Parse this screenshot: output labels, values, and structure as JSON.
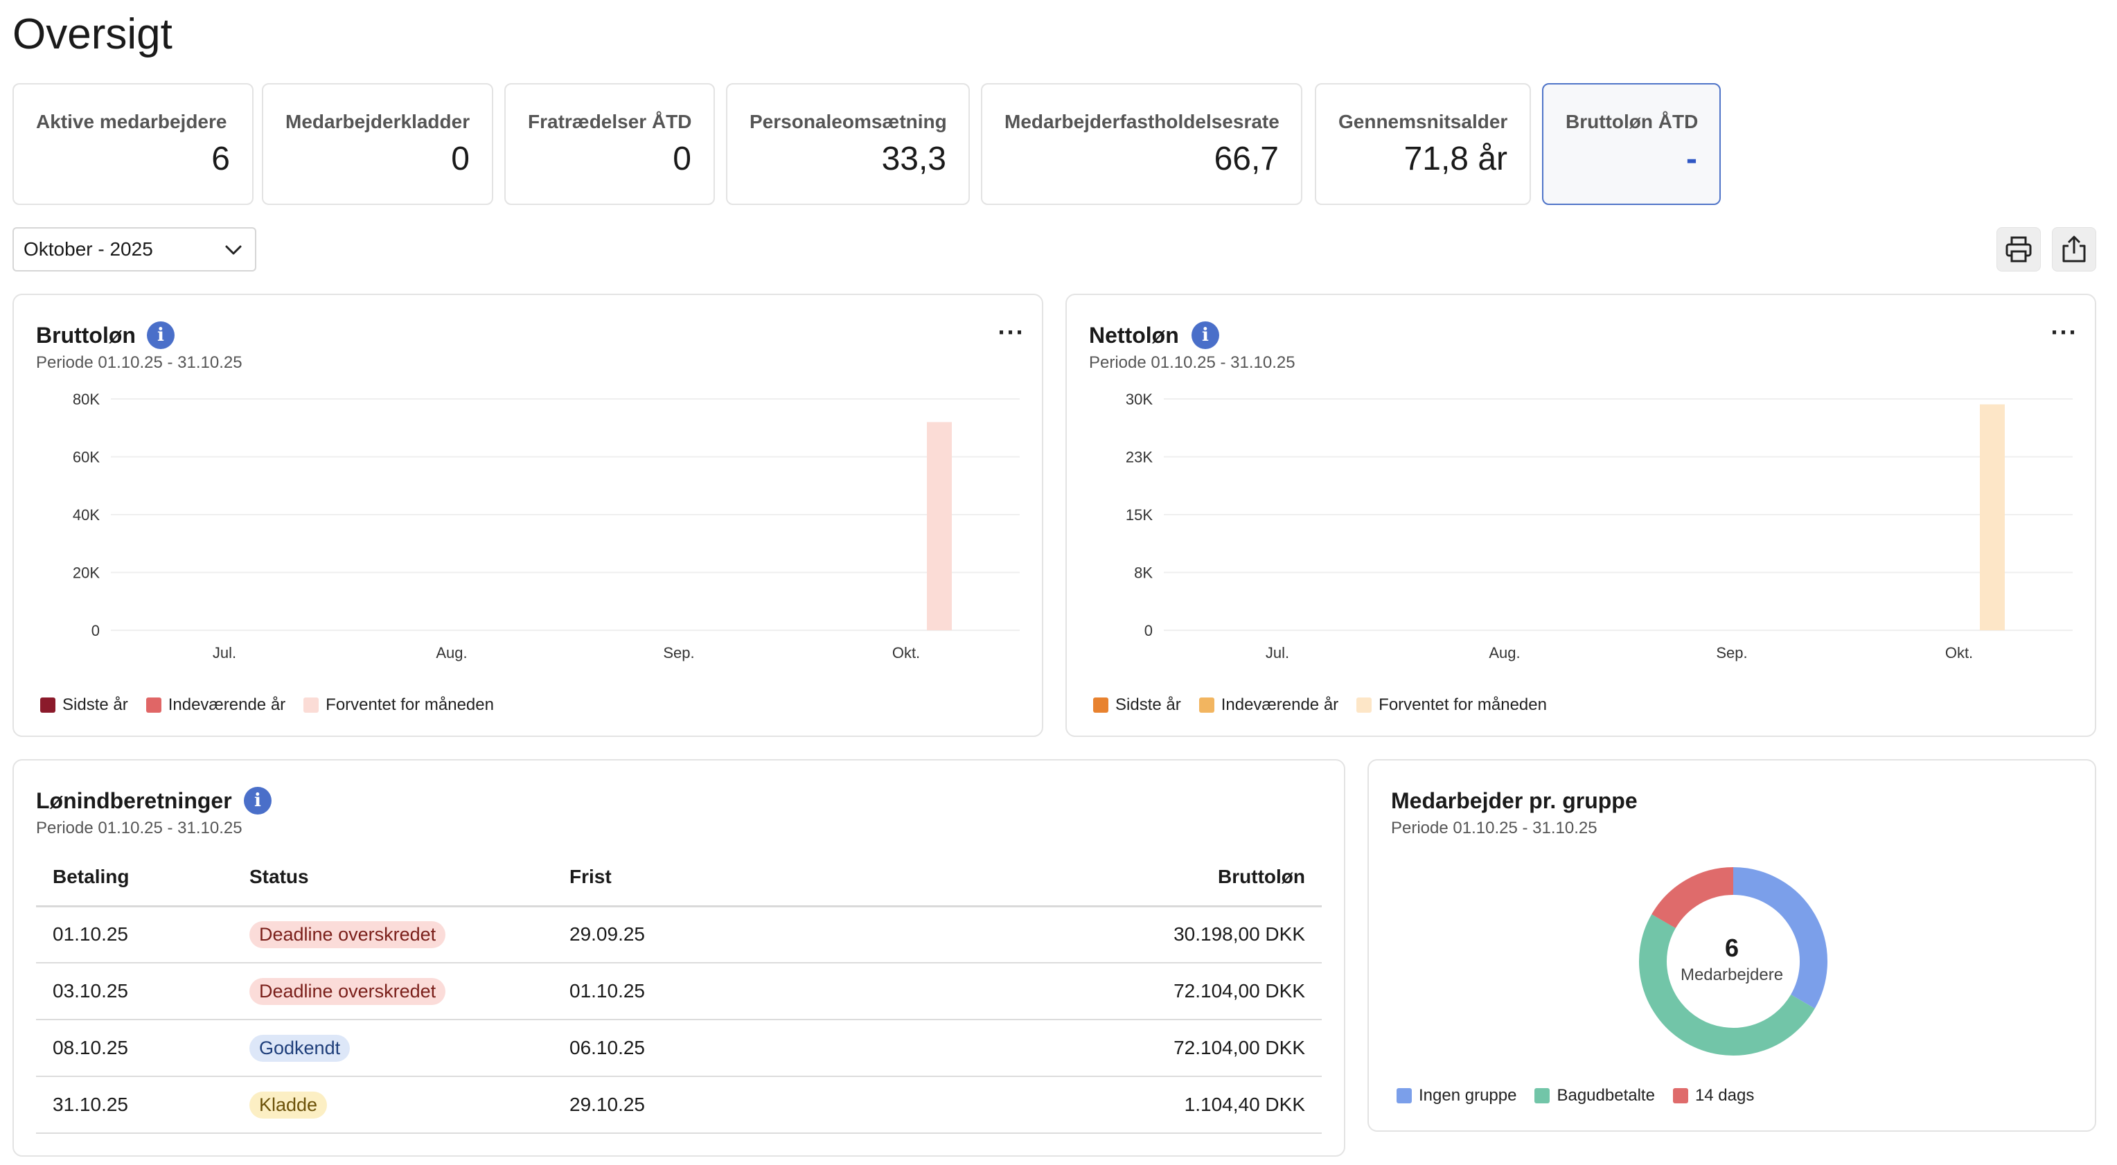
{
  "page": {
    "title": "Oversigt"
  },
  "kpis": [
    {
      "label": "Aktive medarbejdere",
      "value": "6"
    },
    {
      "label": "Medarbejderkladder",
      "value": "0"
    },
    {
      "label": "Fratrædelser ÅTD",
      "value": "0"
    },
    {
      "label": "Personaleomsætning",
      "value": "33,3"
    },
    {
      "label": "Medarbejderfastholdelsesrate",
      "value": "66,7"
    },
    {
      "label": "Gennemsnitsalder",
      "value": "71,8 år"
    },
    {
      "label": "Bruttoløn ÅTD",
      "value": "-"
    }
  ],
  "period_select": {
    "value": "Oktober - 2025"
  },
  "toolbar": {
    "print_icon": "printer-icon",
    "export_icon": "share-export-icon"
  },
  "gross_card": {
    "title": "Bruttoløn",
    "subtitle": "Periode 01.10.25 - 31.10.25",
    "more": "···",
    "legend": [
      {
        "label": "Sidste år",
        "color": "#8b1a2b"
      },
      {
        "label": "Indeværende år",
        "color": "#e06666"
      },
      {
        "label": "Forventet for måneden",
        "color": "#fbdcd6"
      }
    ]
  },
  "net_card": {
    "title": "Nettoløn",
    "subtitle": "Periode 01.10.25 - 31.10.25",
    "more": "···",
    "legend": [
      {
        "label": "Sidste år",
        "color": "#e8822f"
      },
      {
        "label": "Indeværende år",
        "color": "#f2b560"
      },
      {
        "label": "Forventet for måneden",
        "color": "#fde6c7"
      }
    ]
  },
  "payroll_card": {
    "title": "Lønindberetninger",
    "subtitle": "Periode 01.10.25 - 31.10.25",
    "columns": {
      "payment": "Betaling",
      "status": "Status",
      "deadline": "Frist",
      "gross": "Bruttoløn"
    },
    "rows": [
      {
        "payment": "01.10.25",
        "status": "Deadline overskredet",
        "status_kind": "red",
        "deadline": "29.09.25",
        "gross": "30.198,00 DKK"
      },
      {
        "payment": "03.10.25",
        "status": "Deadline overskredet",
        "status_kind": "red",
        "deadline": "01.10.25",
        "gross": "72.104,00 DKK"
      },
      {
        "payment": "08.10.25",
        "status": "Godkendt",
        "status_kind": "blue",
        "deadline": "06.10.25",
        "gross": "72.104,00 DKK"
      },
      {
        "payment": "31.10.25",
        "status": "Kladde",
        "status_kind": "yellow",
        "deadline": "29.10.25",
        "gross": "1.104,40 DKK"
      }
    ]
  },
  "group_card": {
    "title": "Medarbejder pr. gruppe",
    "subtitle": "Periode 01.10.25 - 31.10.25",
    "center_value": "6",
    "center_label": "Medarbejdere"
  },
  "chart_data": [
    {
      "type": "bar",
      "title": "Bruttoløn",
      "categories": [
        "Jul.",
        "Aug.",
        "Sep.",
        "Okt."
      ],
      "yticks": [
        "0",
        "20K",
        "40K",
        "60K",
        "80K"
      ],
      "ylim": [
        0,
        80000
      ],
      "series": [
        {
          "name": "Sidste år",
          "values": [
            0,
            0,
            0,
            0
          ],
          "color": "#8b1a2b"
        },
        {
          "name": "Indeværende år",
          "values": [
            0,
            0,
            0,
            0
          ],
          "color": "#e06666"
        },
        {
          "name": "Forventet for måneden",
          "values": [
            0,
            0,
            0,
            72000
          ],
          "color": "#fbdcd6"
        }
      ],
      "grid": true,
      "legend": "bottom-left"
    },
    {
      "type": "bar",
      "title": "Nettoløn",
      "categories": [
        "Jul.",
        "Aug.",
        "Sep.",
        "Okt."
      ],
      "yticks": [
        "0",
        "8K",
        "15K",
        "23K",
        "30K"
      ],
      "ylim": [
        0,
        30000
      ],
      "series": [
        {
          "name": "Sidste år",
          "values": [
            0,
            0,
            0,
            0
          ],
          "color": "#e8822f"
        },
        {
          "name": "Indeværende år",
          "values": [
            0,
            0,
            0,
            0
          ],
          "color": "#f2b560"
        },
        {
          "name": "Forventet for måneden",
          "values": [
            0,
            0,
            0,
            29300
          ],
          "color": "#fde6c7"
        }
      ],
      "grid": true,
      "legend": "bottom-left"
    },
    {
      "type": "pie",
      "title": "Medarbejder pr. gruppe",
      "categories": [
        "Ingen gruppe",
        "Bagudbetalte",
        "14 dags"
      ],
      "values": [
        2,
        3,
        1
      ],
      "colors": [
        "#7b9fea",
        "#72c5a8",
        "#df6b6b"
      ],
      "legend": "bottom-left"
    }
  ]
}
